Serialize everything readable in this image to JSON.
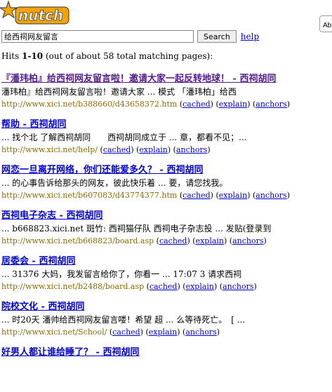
{
  "header": {
    "logo_text": "nutch",
    "about_label": "Ab"
  },
  "search": {
    "query": "给西祠网友留言",
    "button_label": "Search",
    "help_label": "help"
  },
  "hits": {
    "prefix": "Hits ",
    "range": "1-10",
    "suffix": " (out of about 58 total matching pages):"
  },
  "results": [
    {
      "title": "『潘玮柏』给西祠网友留言啦！邀请大家一起反转地球！ - 西祠胡同",
      "snippet": "潘玮柏』给西祠网友留言啦！邀请大家 ... 模式 「潘玮柏」给西",
      "url": "http://www.xici.net/b388660/d43658372.htm"
    },
    {
      "title": "帮助 - 西祠胡同",
      "snippet": "... 找个北 了解西祠胡同　　西祠胡同成立于 ... 章，都看不见；...",
      "url": "http://www.xici.net/help/"
    },
    {
      "title": "网恋一旦离开网络，你们还能爱多久？ - 西祠胡同",
      "snippet": "... 的心事告诉给那头的网友，彼此快乐着 ... 要，请您找我。",
      "url": "http://www.xici.net/b607083/d43774377.htm"
    },
    {
      "title": "西祠电子杂志 - 西祠胡同",
      "snippet": "... b668823.xici.net 斑竹: 西祠猫仔队 西祠电子杂志投 ... 发贴(登录到",
      "url": "http://www.xici.net/b668823/board.asp"
    },
    {
      "title": "居委会 - 西祠胡同",
      "snippet": "... 31376 大妈，我发留言给你了，你看一 ... 17:07 3 请求西祠",
      "url": "http://www.xici.net/b2488/board.asp"
    },
    {
      "title": "院校文化 - 西祠胡同",
      "snippet": "... 时20天 潘帅给西祠网友留言喽！希望 超 ... 么等待死亡。　[ ...",
      "url": "http://www.xici.net/School/"
    },
    {
      "title": "好男人都让谁给睡了？ - 西祠胡同",
      "snippet": "",
      "url": ""
    }
  ],
  "links": {
    "cached": "cached",
    "explain": "explain",
    "anchors": "anchors"
  },
  "colors": {
    "link": "#0000cc",
    "visited": "#551a8b",
    "url": "#8a6a00",
    "logo_orange": "#f2a50a"
  }
}
